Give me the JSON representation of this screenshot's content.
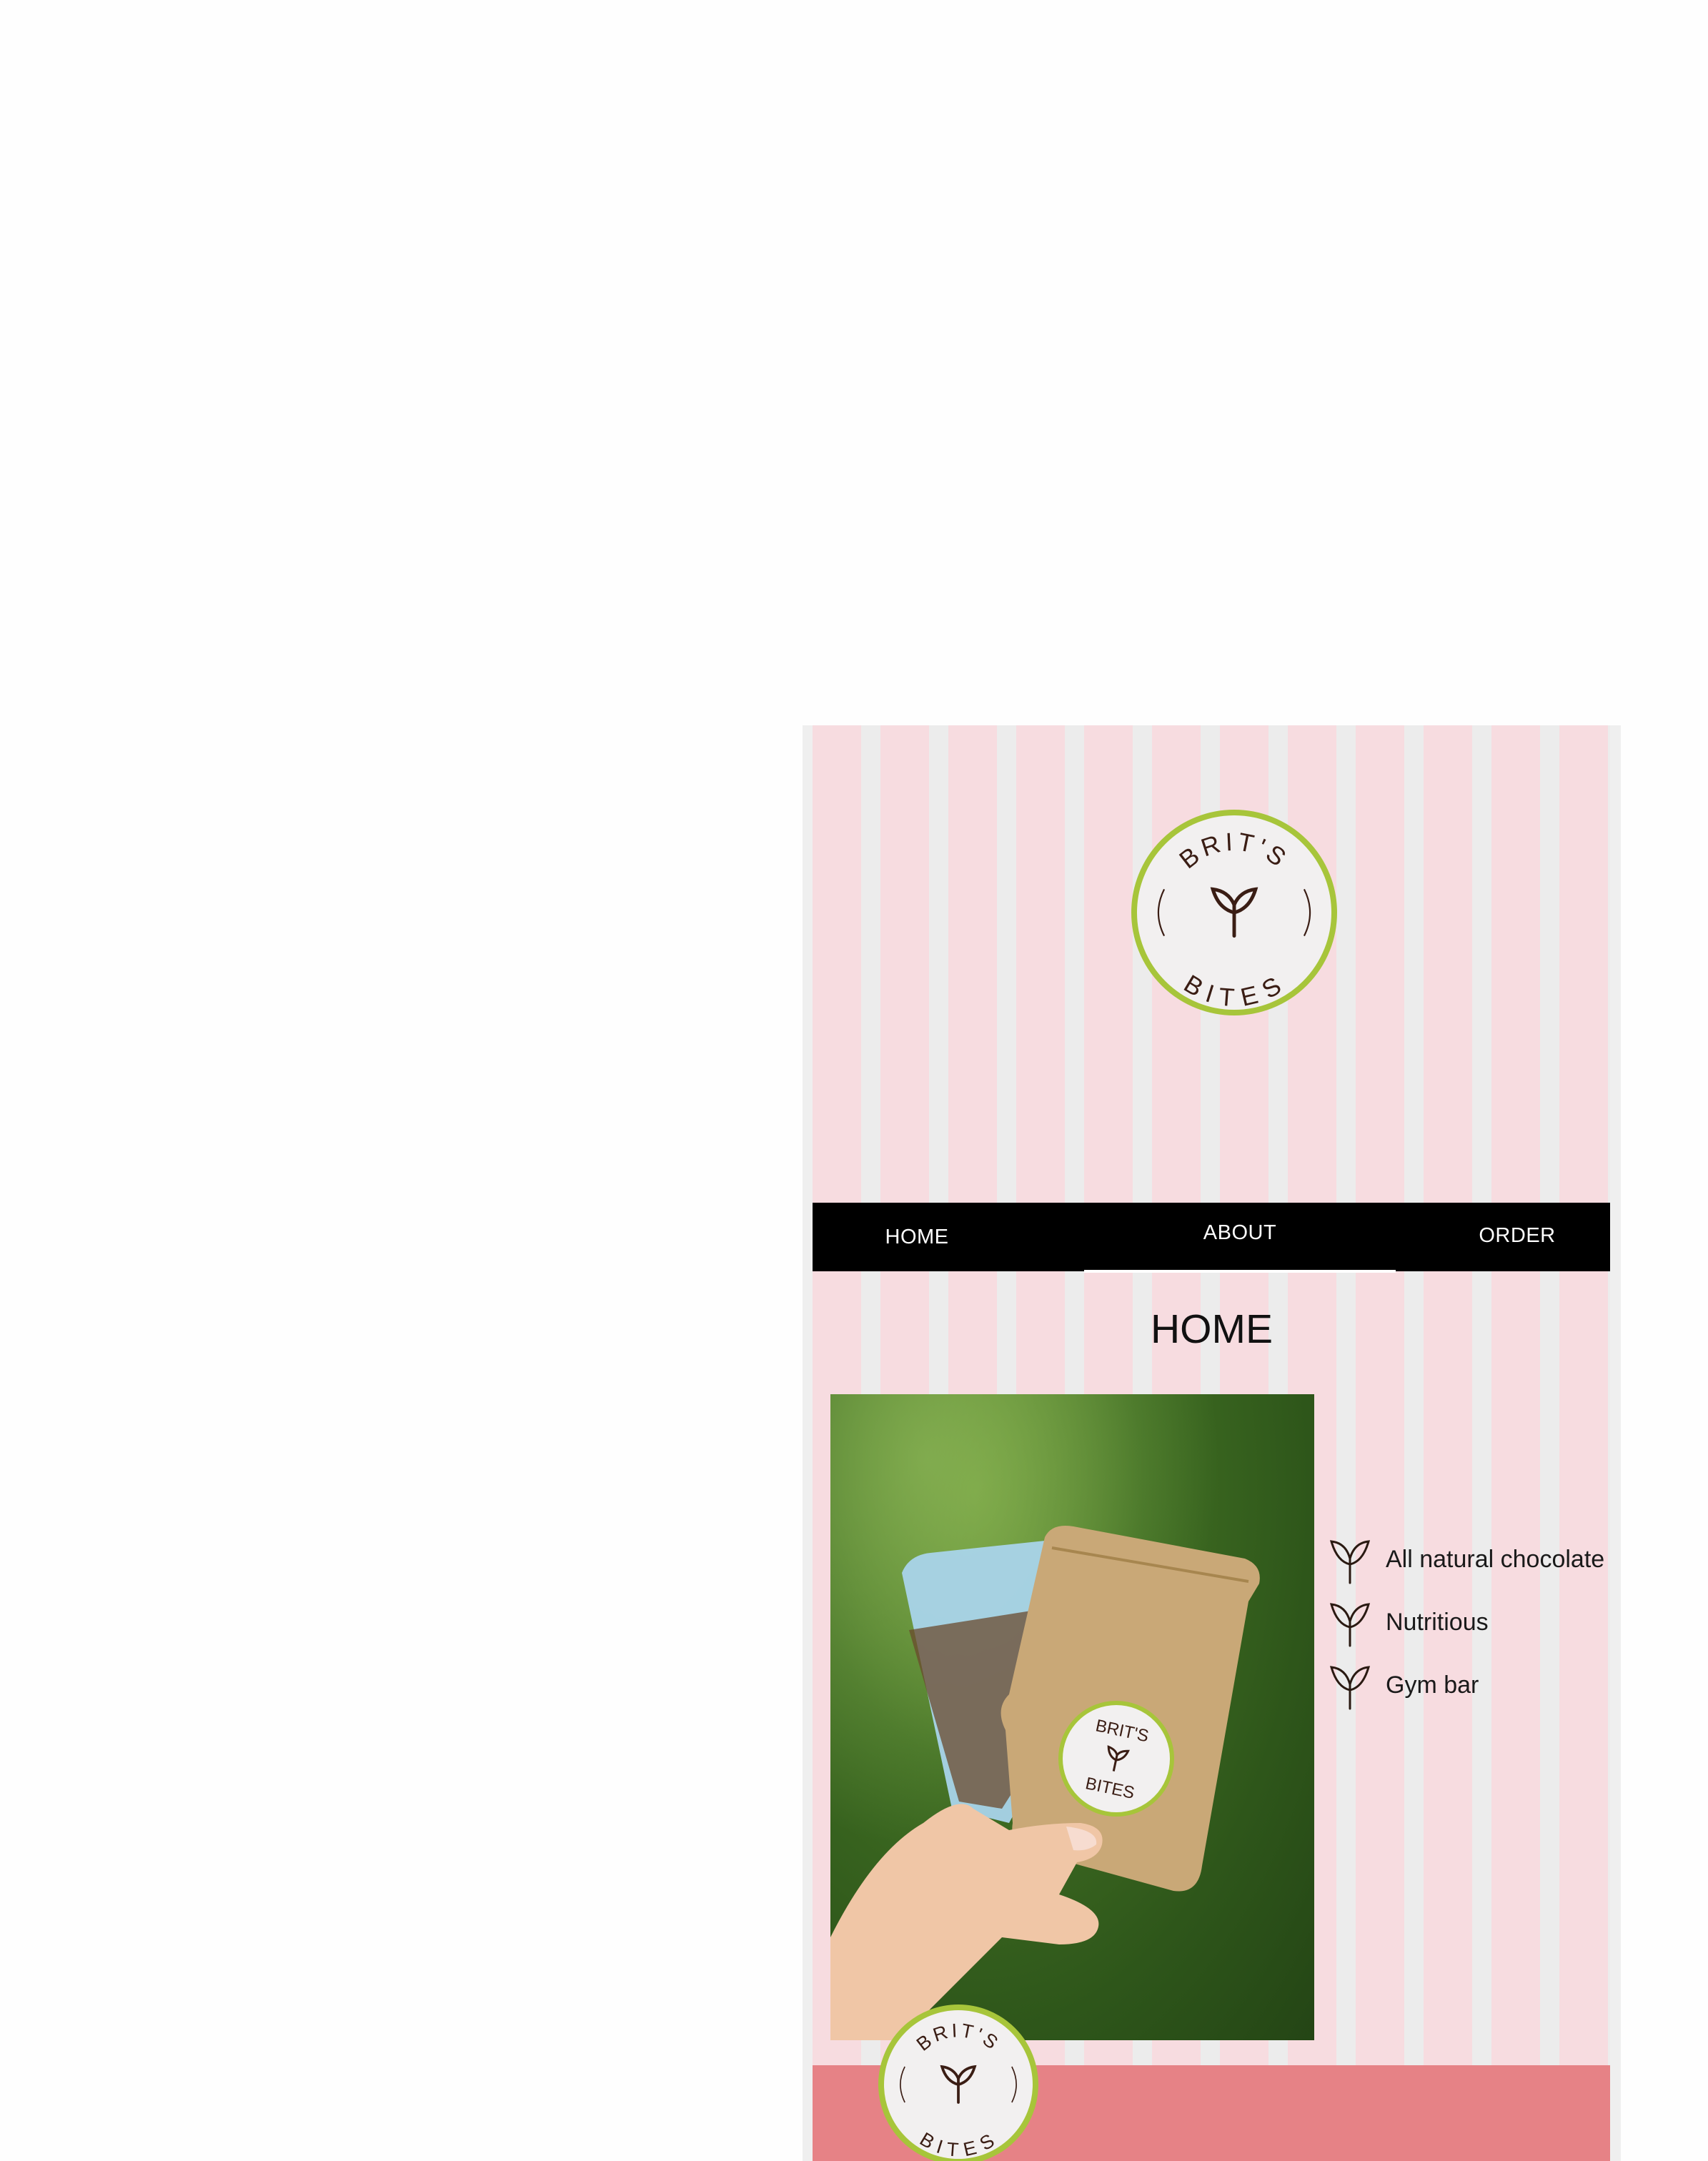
{
  "brand": {
    "logo_top_text": "BRIT'S",
    "logo_bottom_text": "BITES",
    "accent_green": "#a7c53a",
    "stripe_pink": "#f7dce0",
    "footer_color": "#e68286"
  },
  "nav": {
    "items": [
      {
        "label": "HOME"
      },
      {
        "label": "ABOUT"
      },
      {
        "label": "ORDER"
      }
    ]
  },
  "main": {
    "title": "HOME",
    "photo_icon": "product-photo",
    "features": [
      {
        "icon": "sprout-icon",
        "label": "All natural chocolate"
      },
      {
        "icon": "sprout-icon",
        "label": "Nutritious"
      },
      {
        "icon": "sprout-icon",
        "label": "Gym bar"
      }
    ]
  }
}
